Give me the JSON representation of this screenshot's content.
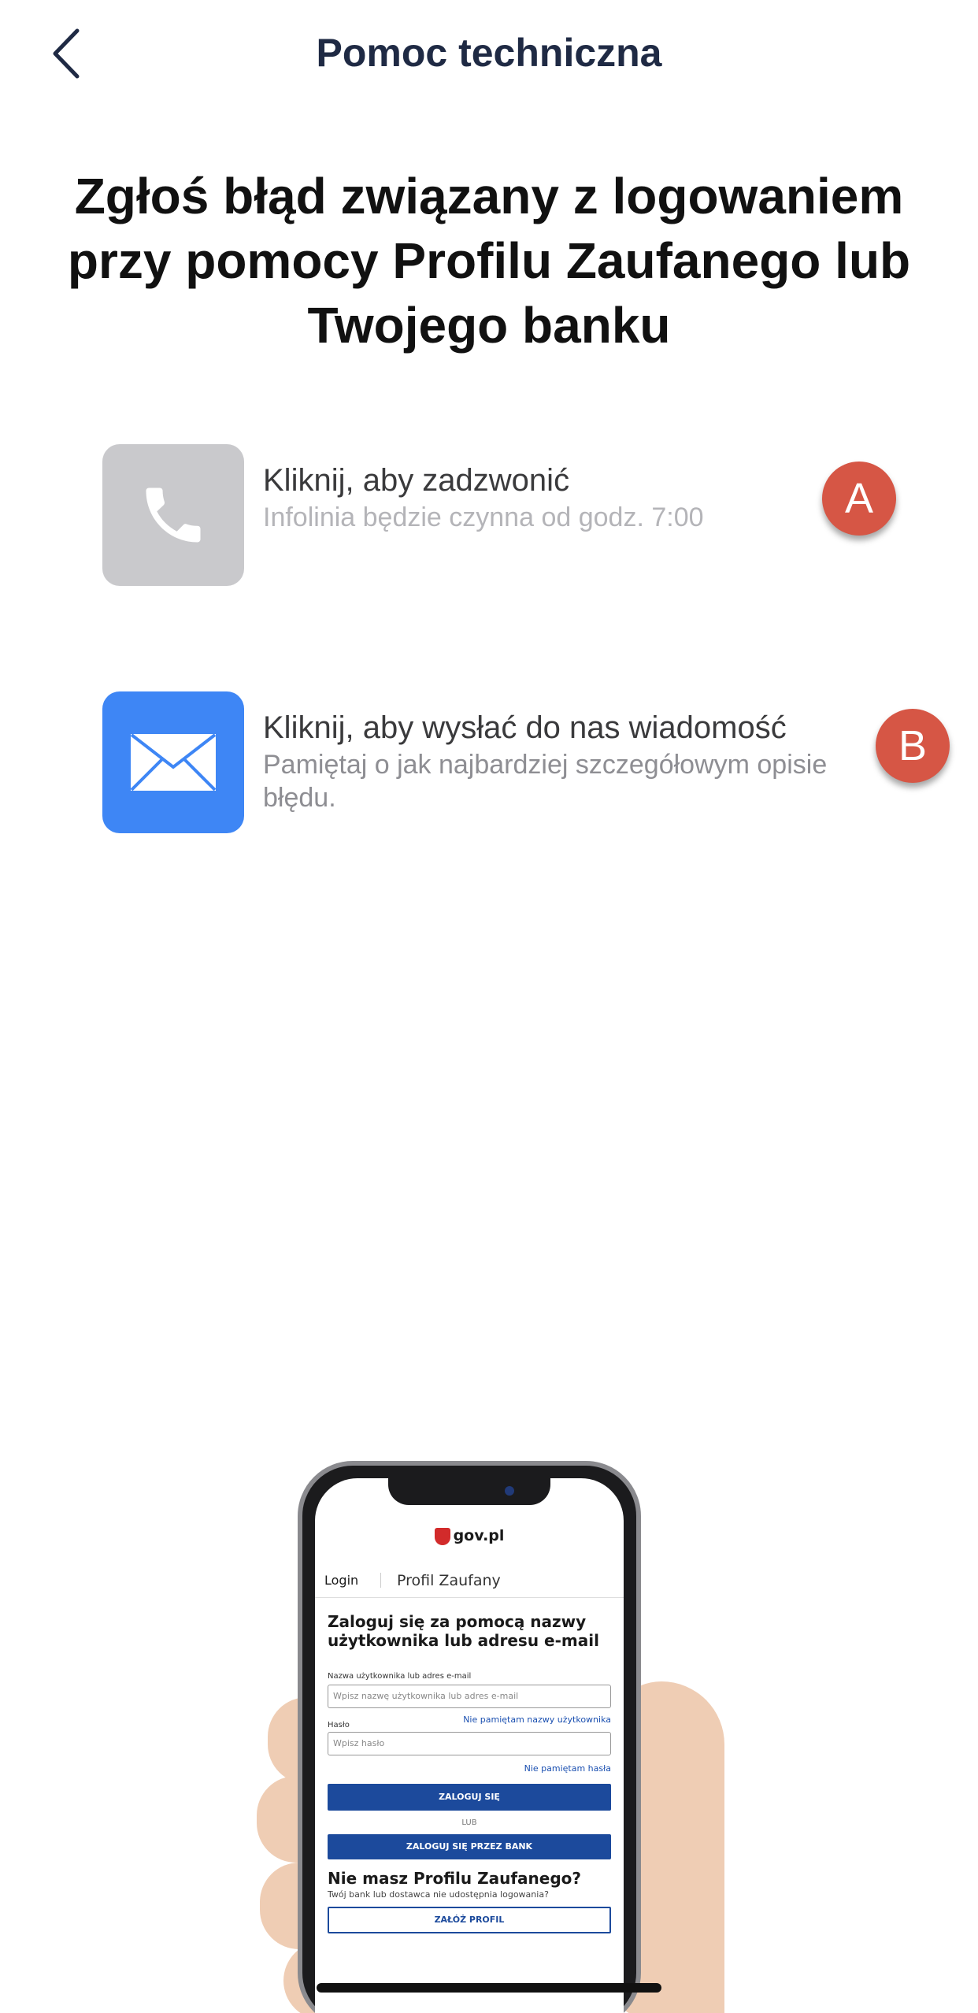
{
  "nav": {
    "back_icon": "chevron-left-icon",
    "title": "Pomoc techniczna"
  },
  "headline": "Zgłoś błąd związany z logowaniem przy pomocy Profilu Zaufanego lub Twojego banku",
  "contact": {
    "call": {
      "icon": "phone-icon",
      "title": "Kliknij, aby zadzwonić",
      "subtitle": "Infolinia będzie czynna od godz. 7:00",
      "badge": "A"
    },
    "message": {
      "icon": "envelope-icon",
      "title": "Kliknij, aby wysłać do nas wiadomość",
      "subtitle": "Pamiętaj o jak najbardziej szczegółowym opisie błędu.",
      "badge": "B"
    }
  },
  "illustration": {
    "brand": "gov.pl",
    "tab_login": "Login",
    "tab_profile": "Profil Zaufany",
    "heading": "Zaloguj się za pomocą nazwy użytkownika lub adresu e-mail",
    "username_label": "Nazwa użytkownika lub adres e-mail",
    "username_placeholder": "Wpisz nazwę użytkownika lub adres e-mail",
    "forgot_username": "Nie pamiętam nazwy użytkownika",
    "password_label": "Hasło",
    "password_placeholder": "Wpisz hasło",
    "forgot_password": "Nie pamiętam hasła",
    "login_button": "ZALOGUJ SIĘ",
    "or": "LUB",
    "bank_button": "ZALOGUJ SIĘ PRZEZ BANK",
    "no_profile_heading": "Nie masz Profilu Zaufanego?",
    "no_profile_text": "Twój bank lub dostawca nie udostępnia logowania?",
    "create_button": "ZAŁÓŻ PROFIL"
  },
  "colors": {
    "nav_title": "#1f2a44",
    "phone_tile": "#c9c9cc",
    "mail_tile": "#3e86f5",
    "badge": "#d65645"
  }
}
